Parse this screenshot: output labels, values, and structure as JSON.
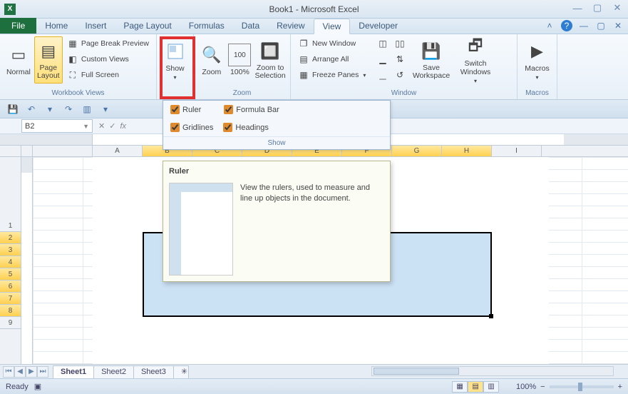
{
  "title": "Book1 - Microsoft Excel",
  "tabs": {
    "file": "File",
    "items": [
      "Home",
      "Insert",
      "Page Layout",
      "Formulas",
      "Data",
      "Review",
      "View",
      "Developer"
    ],
    "active": "View"
  },
  "ribbon": {
    "workbook_views": {
      "normal": "Normal",
      "page_layout": "Page Layout",
      "page_break_preview": "Page Break Preview",
      "custom_views": "Custom Views",
      "full_screen": "Full Screen",
      "label": "Workbook Views"
    },
    "show": {
      "button": "Show",
      "label": "Show"
    },
    "zoom": {
      "zoom": "Zoom",
      "hundred": "100%",
      "to_selection": "Zoom to Selection",
      "label": "Zoom"
    },
    "window": {
      "new_window": "New Window",
      "arrange_all": "Arrange All",
      "freeze_panes": "Freeze Panes",
      "save_workspace": "Save Workspace",
      "switch_windows": "Switch Windows",
      "label": "Window"
    },
    "macros": {
      "macros": "Macros",
      "label": "Macros"
    }
  },
  "show_panel": {
    "ruler": "Ruler",
    "formula_bar": "Formula Bar",
    "gridlines": "Gridlines",
    "headings": "Headings",
    "footer": "Show",
    "ruler_checked": true,
    "formula_bar_checked": true,
    "gridlines_checked": true,
    "headings_checked": true
  },
  "tooltip": {
    "title": "Ruler",
    "desc": "View the rulers, used to measure and line up objects in the document."
  },
  "namebox": "B2",
  "columns": [
    "A",
    "B",
    "C",
    "D",
    "E",
    "F",
    "G",
    "H",
    "I"
  ],
  "selected_cols": [
    "B",
    "C",
    "D",
    "E",
    "F",
    "G",
    "H"
  ],
  "rows": [
    "1",
    "2",
    "3",
    "4",
    "5",
    "6",
    "7",
    "8",
    "9"
  ],
  "selected_rows": [
    "2",
    "3",
    "4",
    "5",
    "6",
    "7",
    "8"
  ],
  "sheets": {
    "items": [
      "Sheet1",
      "Sheet2",
      "Sheet3"
    ],
    "active": "Sheet1"
  },
  "status": {
    "ready": "Ready",
    "zoom": "100%"
  }
}
